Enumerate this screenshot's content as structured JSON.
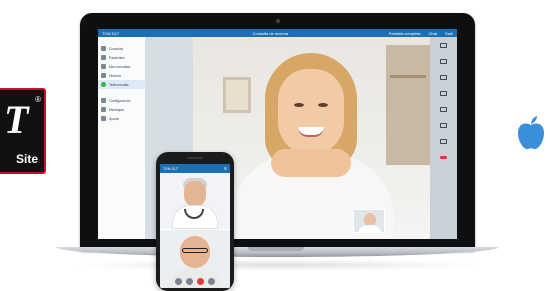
{
  "logo": {
    "symbol": "T",
    "registered": "®",
    "caption": "Site"
  },
  "apple_icon": "apple-icon",
  "laptop_app": {
    "brand": "TOM DLT",
    "center_title": "Consulta de doctora",
    "right_items": [
      "Pantalla completa",
      "Chat",
      "Salir"
    ],
    "sidebar": {
      "section_title": "",
      "items": [
        {
          "label": "Consulta",
          "active": false
        },
        {
          "label": "Pacientes",
          "active": false
        },
        {
          "label": "Mis consultas",
          "active": false
        },
        {
          "label": "Historia",
          "active": false
        },
        {
          "label": "Teleconsulta",
          "active": true
        },
        {
          "label": "Configuración",
          "active": false
        },
        {
          "label": "Mensajes",
          "active": false
        },
        {
          "label": "Ayuda",
          "active": false
        }
      ]
    },
    "right_toolbar": [
      "monitor-icon",
      "camera-icon",
      "microphone-icon",
      "user-icon",
      "add-user-icon",
      "chat-icon",
      "share-icon",
      "hang-up-icon"
    ]
  },
  "phone_app": {
    "brand": "TOM DLT",
    "controls": [
      "mute-icon",
      "camera-icon",
      "end-call-icon",
      "settings-icon"
    ]
  },
  "colors": {
    "brand_blue": "#1c6fb3",
    "active_green": "#2fb44a",
    "end_call_red": "#d93838"
  }
}
